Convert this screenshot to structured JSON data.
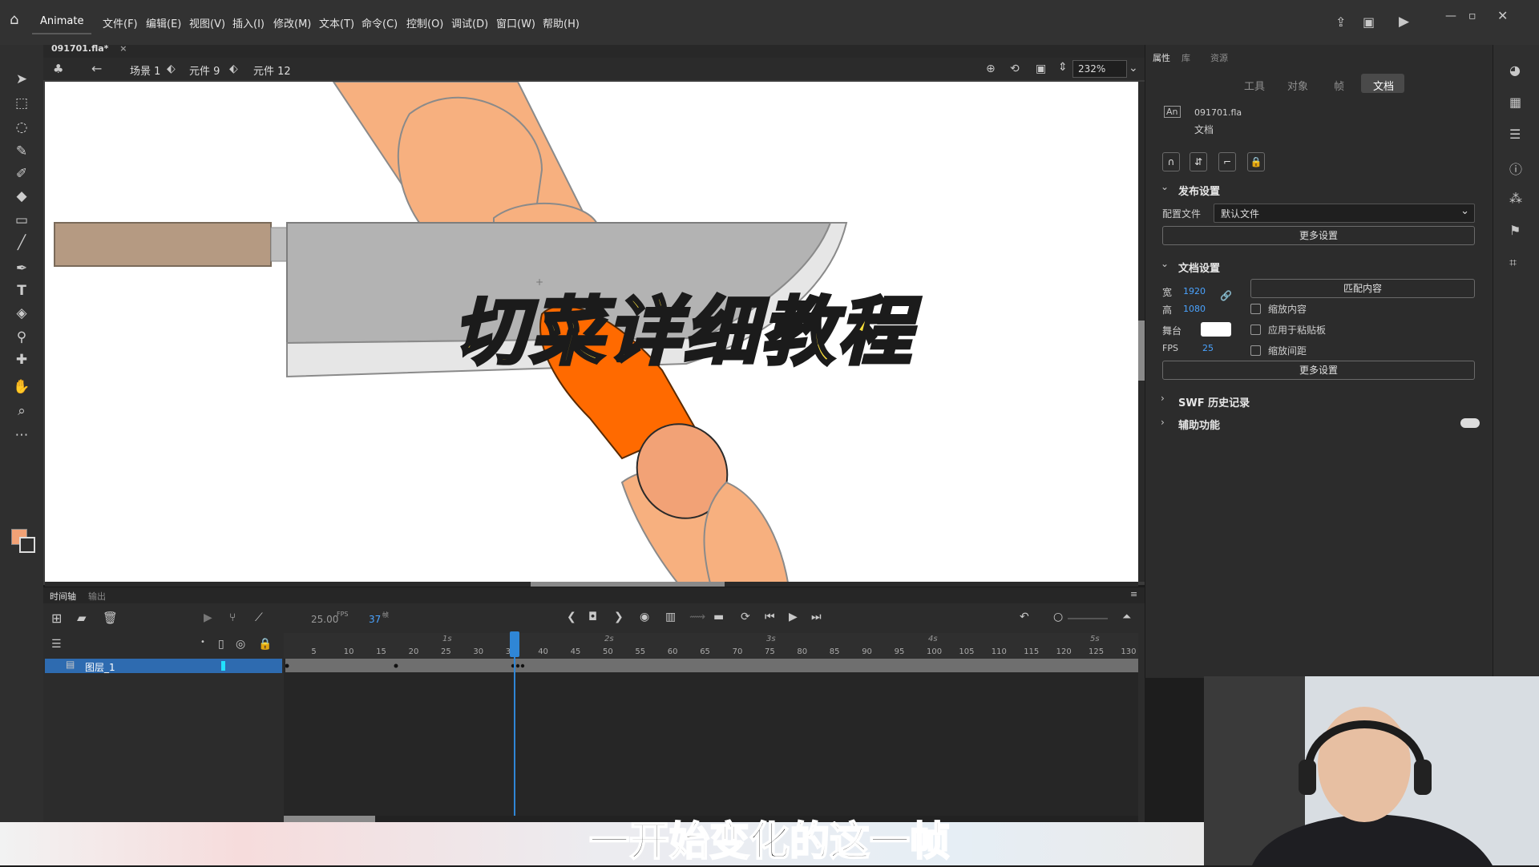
{
  "app": {
    "name": "Animate",
    "menu": [
      "文件(F)",
      "编辑(E)",
      "视图(V)",
      "插入(I)",
      "修改(M)",
      "文本(T)",
      "命令(C)",
      "控制(O)",
      "调试(D)",
      "窗口(W)",
      "帮助(H)"
    ]
  },
  "document": {
    "tab": "091701.fla*",
    "breadcrumbs": [
      "场景 1",
      "元件 9",
      "元件 12"
    ],
    "zoom": "232%"
  },
  "properties": {
    "tabs_top": [
      "属性",
      "库",
      "资源"
    ],
    "tabs": [
      "工具",
      "对象",
      "帧",
      "文档"
    ],
    "active_tab": "文档",
    "file_name": "091701.fla",
    "file_type": "文档",
    "publish_section": "发布设置",
    "profile_label": "配置文件",
    "profile_value": "默认文件",
    "more_settings": "更多设置",
    "doc_section": "文档设置",
    "width_label": "宽",
    "width_value": "1920",
    "height_label": "高",
    "height_value": "1080",
    "match_content": "匹配内容",
    "scale_content": "缩放内容",
    "apply_pasteboard": "应用于粘贴板",
    "scale_spacing": "缩放间距",
    "stage_label": "舞台",
    "stage_color": "#ffffff",
    "fps_label": "FPS",
    "fps_value": "25",
    "swf_history": "SWF 历史记录",
    "accessibility": "辅助功能"
  },
  "timeline": {
    "tabs": [
      "时间轴",
      "输出"
    ],
    "fps": "25.00",
    "fps_unit": "FPS",
    "current_frame": "37",
    "frame_unit": "帧",
    "seconds_marks": [
      "1s",
      "2s",
      "3s",
      "4s",
      "5s"
    ],
    "frame_marks": [
      "5",
      "10",
      "15",
      "20",
      "25",
      "30",
      "35",
      "40",
      "45",
      "50",
      "55",
      "60",
      "65",
      "70",
      "75",
      "80",
      "85",
      "90",
      "95",
      "100",
      "105",
      "110",
      "115",
      "120",
      "125",
      "130"
    ],
    "layer_name": "图层_1"
  },
  "overlay": {
    "title": "切菜详细教程",
    "subtitle": "一开始变化的这一帧"
  },
  "colors": {
    "accent": "#2f86d6",
    "title_fill": "#ffe23a",
    "knife_blade": "#b4b4b4",
    "handle": "#b59a82",
    "finger": "#f7b07f",
    "carrot": "#ff6a00"
  }
}
